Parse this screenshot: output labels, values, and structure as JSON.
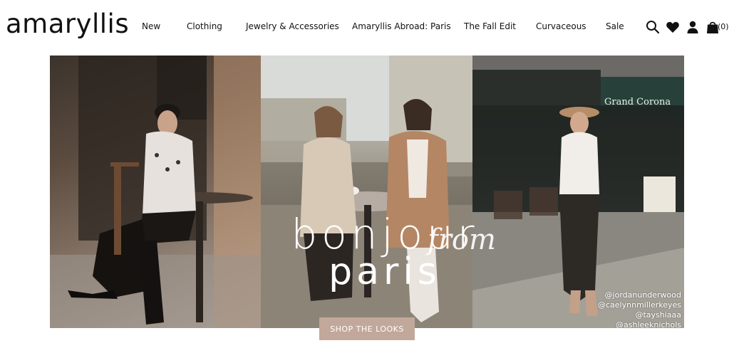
{
  "brand": {
    "logo": "amaryllis"
  },
  "nav": {
    "items": [
      {
        "label": "New"
      },
      {
        "label": "Clothing"
      },
      {
        "label": "Jewelry & Accessories"
      },
      {
        "label": "Amaryllis Abroad: Paris"
      },
      {
        "label": "The Fall Edit"
      },
      {
        "label": "Curvaceous"
      },
      {
        "label": "Sale"
      }
    ]
  },
  "header_icons": {
    "search": "search-icon",
    "wishlist": "heart-icon",
    "account": "user-icon",
    "bag": "bag-icon",
    "bag_count": "(0)"
  },
  "hero": {
    "title_line1": "bonjour",
    "title_script": "from",
    "title_line2": "paris",
    "credits": [
      "@jordanunderwood",
      "@caelynnmillerkeyes",
      "@tayshiaaa",
      "@ashleeknichols"
    ],
    "sign_text": "Grand Corona",
    "cta_label": "SHOP THE LOOKS"
  },
  "colors": {
    "cta_background": "#c2a89a",
    "text": "#111111",
    "background": "#ffffff"
  }
}
